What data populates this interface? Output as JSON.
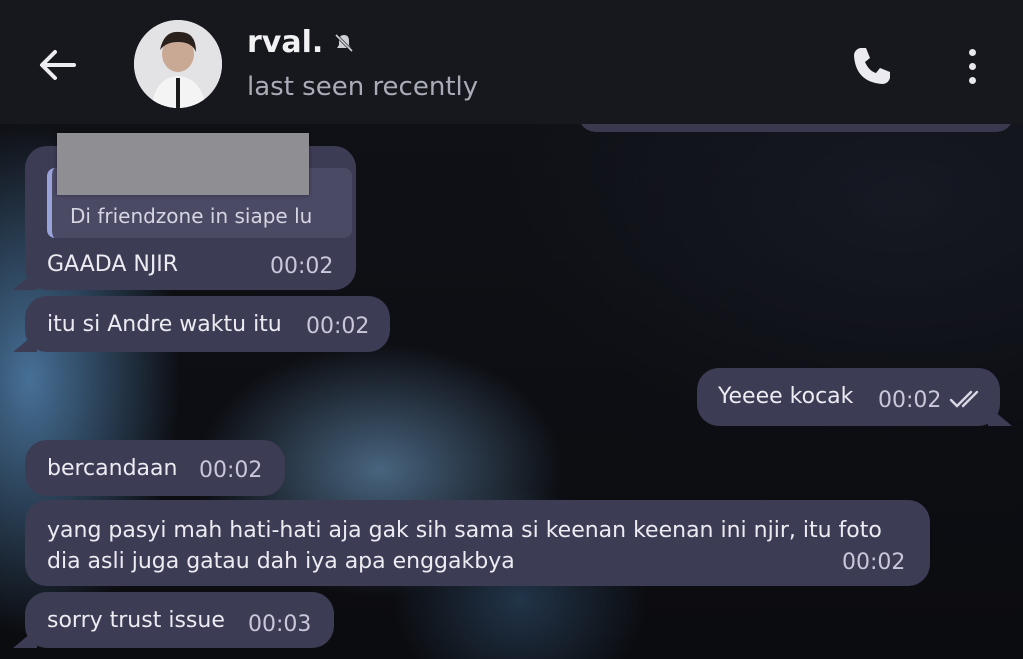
{
  "header": {
    "contact_name": "rval.",
    "status": "last seen recently",
    "back_icon": "arrow-left-icon",
    "muted_icon": "bell-off-icon",
    "call_icon": "phone-icon",
    "menu_icon": "more-vertical-icon"
  },
  "messages": [
    {
      "side": "in",
      "reply_to": "Di friendzone in siape lu",
      "text": "GAADA NJIR",
      "time": "00:02"
    },
    {
      "side": "in",
      "text": "itu si Andre waktu itu",
      "time": "00:02"
    },
    {
      "side": "out",
      "text": "Yeeee kocak",
      "time": "00:02",
      "status": "read"
    },
    {
      "side": "in",
      "text": "bercandaan",
      "time": "00:02"
    },
    {
      "side": "in",
      "text_line1": "yang pasyi mah hati-hati aja gak sih sama si keenan keenan ini njir, itu foto",
      "text_line2": "dia asli juga gatau dah iya apa enggakbya",
      "time": "00:02"
    },
    {
      "side": "in",
      "text": "sorry trust issue",
      "time": "00:03"
    }
  ],
  "colors": {
    "header_bg": "#17181e",
    "bubble_bg": "#3d3c55",
    "reply_accent": "#9aa3d9"
  }
}
